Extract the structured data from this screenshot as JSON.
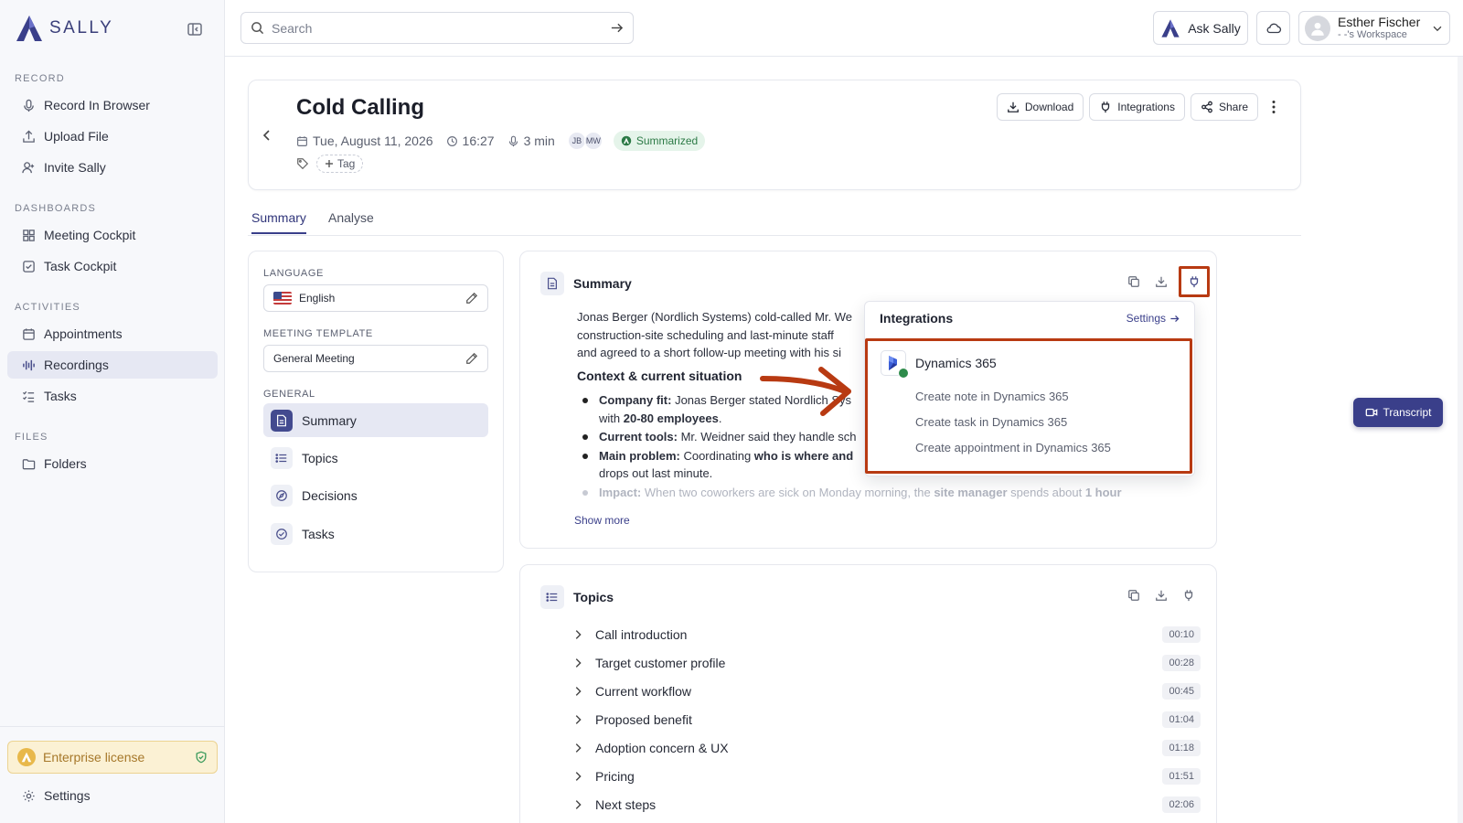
{
  "brand": {
    "name": "SALLY"
  },
  "sidebar": {
    "sections": [
      {
        "label": "RECORD",
        "items": [
          {
            "label": "Record In Browser",
            "icon": "mic-icon"
          },
          {
            "label": "Upload File",
            "icon": "upload-icon"
          },
          {
            "label": "Invite Sally",
            "icon": "user-plus-icon"
          }
        ]
      },
      {
        "label": "DASHBOARDS",
        "items": [
          {
            "label": "Meeting Cockpit",
            "icon": "grid-icon"
          },
          {
            "label": "Task Cockpit",
            "icon": "checkbox-icon"
          }
        ]
      },
      {
        "label": "ACTIVITIES",
        "items": [
          {
            "label": "Appointments",
            "icon": "calendar-icon"
          },
          {
            "label": "Recordings",
            "icon": "waveform-icon",
            "active": true
          },
          {
            "label": "Tasks",
            "icon": "task-list-icon"
          }
        ]
      },
      {
        "label": "FILES",
        "items": [
          {
            "label": "Folders",
            "icon": "folder-icon"
          }
        ]
      }
    ],
    "license": "Enterprise license",
    "settings": "Settings"
  },
  "topbar": {
    "search_placeholder": "Search",
    "ask_label": "Ask Sally",
    "user_name": "Esther Fischer",
    "workspace": "- -'s Workspace"
  },
  "meeting": {
    "title": "Cold Calling",
    "date": "Tue, August 11, 2026",
    "time": "16:27",
    "duration": "3 min",
    "participants": [
      "JB",
      "MW"
    ],
    "status": "Summarized",
    "tag_label": "Tag",
    "actions": {
      "download": "Download",
      "integrations": "Integrations",
      "share": "Share"
    }
  },
  "tabs": {
    "summary": "Summary",
    "analyse": "Analyse"
  },
  "left_panel": {
    "language_label": "LANGUAGE",
    "language_value": "English",
    "template_label": "MEETING TEMPLATE",
    "template_value": "General Meeting",
    "general_label": "GENERAL",
    "nav": [
      {
        "label": "Summary",
        "icon": "document-icon",
        "active": true
      },
      {
        "label": "Topics",
        "icon": "list-icon"
      },
      {
        "label": "Decisions",
        "icon": "compass-icon"
      },
      {
        "label": "Tasks",
        "icon": "check-circle-icon"
      }
    ]
  },
  "summary": {
    "title": "Summary",
    "intro_l1": "Jonas Berger (Nordlich Systems) cold-called Mr. We",
    "intro_l2": "construction-site scheduling and last-minute staff",
    "intro_l3": "and agreed to a short follow-up meeting with his si",
    "subheading": "Context & current situation",
    "bullets": [
      {
        "label": "Company fit:",
        "l1": " Jonas Berger stated Nordlich Sys",
        "l2a": "with ",
        "l2b": "20-80 employees",
        "l2c": "."
      },
      {
        "label": "Current tools:",
        "l1": " Mr. Weidner said they handle sch"
      },
      {
        "label": "Main problem:",
        "l1": " Coordinating ",
        "l1b": "who is where and",
        "l2": "drops out last minute."
      },
      {
        "label": "Impact:",
        "l1": " When two coworkers are sick on Monday morning, the ",
        "l1b": "site manager",
        "l1c": " spends about ",
        "l1d": "1 hour"
      }
    ],
    "show_more": "Show more"
  },
  "topics": {
    "title": "Topics",
    "items": [
      {
        "label": "Call introduction",
        "time": "00:10"
      },
      {
        "label": "Target customer profile",
        "time": "00:28"
      },
      {
        "label": "Current workflow",
        "time": "00:45"
      },
      {
        "label": "Proposed benefit",
        "time": "01:04"
      },
      {
        "label": "Adoption concern & UX",
        "time": "01:18"
      },
      {
        "label": "Pricing",
        "time": "01:51"
      },
      {
        "label": "Next steps",
        "time": "02:06"
      }
    ]
  },
  "integrations_popover": {
    "title": "Integrations",
    "settings": "Settings",
    "provider": "Dynamics 365",
    "actions": [
      "Create note in Dynamics 365",
      "Create task in Dynamics 365",
      "Create appointment in Dynamics 365"
    ]
  },
  "transcript_label": "Transcript",
  "colors": {
    "accent": "#3a3f8a",
    "highlight": "#b83a12",
    "success": "#2c7a46",
    "license": "#fbf1d4"
  }
}
